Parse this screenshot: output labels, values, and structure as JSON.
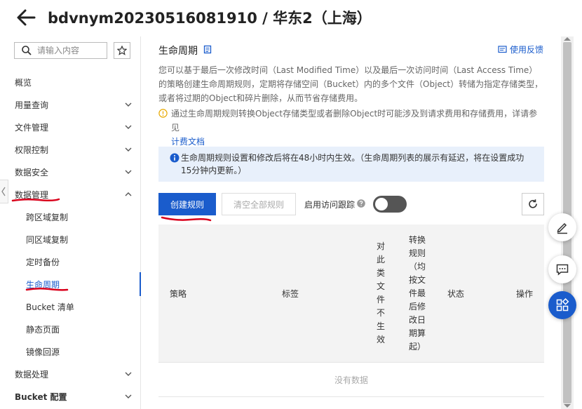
{
  "header": {
    "bucket_title": "bdvnym20230516081910 / 华东2（上海）"
  },
  "sidebar": {
    "search_placeholder": "请输入内容",
    "items": [
      {
        "label": "概览"
      },
      {
        "label": "用量查询"
      },
      {
        "label": "文件管理"
      },
      {
        "label": "权限控制"
      },
      {
        "label": "数据安全"
      },
      {
        "label": "数据管理"
      },
      {
        "label": "跨区域复制"
      },
      {
        "label": "同区域复制"
      },
      {
        "label": "定时备份"
      },
      {
        "label": "生命周期"
      },
      {
        "label": "Bucket 清单"
      },
      {
        "label": "静态页面"
      },
      {
        "label": "镜像回源"
      },
      {
        "label": "数据处理"
      },
      {
        "label": "Bucket 配置"
      }
    ]
  },
  "main": {
    "title": "生命周期",
    "feedback_label": "使用反馈",
    "description": "您可以基于最后一次修改时间（Last Modified Time）以及最后一次访问时间（Last Access Time）的策略创建生命周期规则，定期将存储空间（Bucket）内的多个文件（Object）转储为指定存储类型，或者将过期的Object和碎片删除，从而节省存储费用。",
    "warning_text": "通过生命周期规则转换Object存储类型或者删除Object时可能涉及到请求费用和存储费用，详请参见",
    "warning_link": "计费文档",
    "info_text": "生命周期规则设置和修改后将在48小时内生效。（生命周期列表的展示有延迟，将在设置成功15分钟内更新。）",
    "create_button": "创建规则",
    "clear_button": "清空全部规则",
    "access_tracking_label": "启用访问跟踪",
    "access_tracking_enabled": false,
    "table": {
      "columns": [
        "策略",
        "标签",
        "对此类文件不生效",
        "转换规则（均按文件最后修改日期算起）",
        "状态",
        "操作"
      ],
      "empty_text": "没有数据"
    }
  },
  "colors": {
    "primary": "#1a5ccc",
    "annotation_red": "#d9001b",
    "info_bg": "#e8f0fb"
  }
}
